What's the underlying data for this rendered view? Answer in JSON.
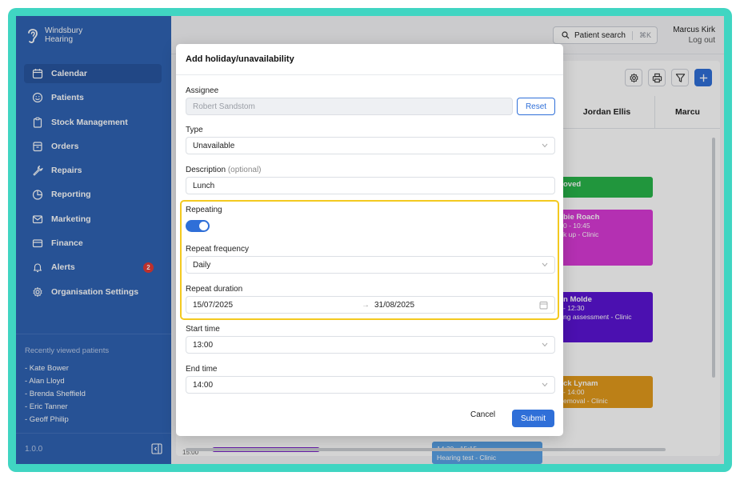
{
  "brand": {
    "line1": "Windsbury",
    "line2": "Hearing"
  },
  "sidebar": {
    "items": [
      {
        "label": "Calendar",
        "icon": "calendar-icon"
      },
      {
        "label": "Patients",
        "icon": "smile-icon"
      },
      {
        "label": "Stock Management",
        "icon": "clipboard-icon"
      },
      {
        "label": "Orders",
        "icon": "box-icon"
      },
      {
        "label": "Repairs",
        "icon": "wrench-icon"
      },
      {
        "label": "Reporting",
        "icon": "pie-chart-icon"
      },
      {
        "label": "Marketing",
        "icon": "mail-icon"
      },
      {
        "label": "Finance",
        "icon": "card-icon"
      },
      {
        "label": "Alerts",
        "icon": "bell-icon",
        "badge": "2"
      },
      {
        "label": "Organisation Settings",
        "icon": "gear-icon"
      }
    ],
    "recent_title": "Recently viewed patients",
    "recent": [
      "- Kate Bower",
      "- Alan Lloyd",
      "- Brenda Sheffield",
      "- Eric Tanner",
      "- Geoff Philip"
    ],
    "version": "1.0.0"
  },
  "topbar": {
    "search_label": "Patient search",
    "search_shortcut": "⌘K",
    "user_name": "Marcus Kirk",
    "logout": "Log out"
  },
  "calendar": {
    "columns": [
      "Jordan Ellis",
      "Marcu"
    ],
    "events": [
      {
        "title": "oved",
        "time": "",
        "desc": "",
        "color": "#28b54a"
      },
      {
        "title": "bie Roach",
        "time": "0 - 10:45",
        "desc": "k up - Clinic",
        "color": "#d93ad6"
      },
      {
        "title": "n Molde",
        "time": "- 12:30",
        "desc": "ng assessment - Clinic",
        "color": "#5b14d4"
      },
      {
        "title": "ck Lynam",
        "time": "- 14:00",
        "desc": "emoval - Clinic",
        "color": "#e39a1c"
      },
      {
        "title": "",
        "time": "14:30 - 15:15",
        "desc": "Hearing test - Clinic",
        "color": "#5aa2e6"
      }
    ],
    "time_label": "15:00"
  },
  "modal": {
    "title": "Add holiday/unavailability",
    "assignee_label": "Assignee",
    "assignee_value": "Robert Sandstom",
    "reset_label": "Reset",
    "type_label": "Type",
    "type_value": "Unavailable",
    "description_label": "Description",
    "description_optional": "(optional)",
    "description_value": "Lunch",
    "repeating_label": "Repeating",
    "repeating_on": true,
    "frequency_label": "Repeat frequency",
    "frequency_value": "Daily",
    "duration_label": "Repeat duration",
    "duration_start": "15/07/2025",
    "duration_arrow": "→",
    "duration_end": "31/08/2025",
    "start_label": "Start time",
    "start_value": "13:00",
    "end_label": "End time",
    "end_value": "14:00",
    "cancel_label": "Cancel",
    "submit_label": "Submit"
  },
  "colors": {
    "sidebar": "#2f63b4",
    "accent": "#2f6fd8",
    "highlight": "#f3c920",
    "frame": "#40d5c2"
  }
}
